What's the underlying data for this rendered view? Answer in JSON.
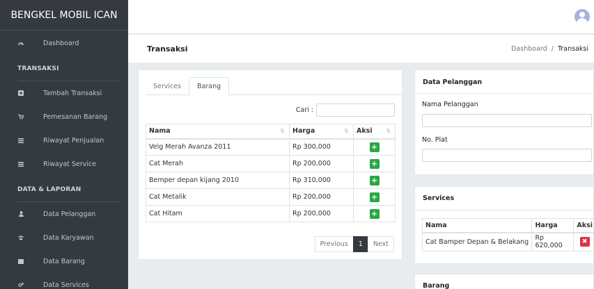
{
  "brand": "BENGKEL MOBIL ICAN",
  "sidebar": {
    "dashboard": {
      "label": "Dashboard",
      "icon": "dashboard-icon"
    },
    "section_transaksi": "TRANSAKSI",
    "transaksi_items": [
      {
        "label": "Tambah Transaksi",
        "icon": "plus-square-icon"
      },
      {
        "label": "Pemesanan Barang",
        "icon": "cart-icon"
      },
      {
        "label": "Riwayat Penjualan",
        "icon": "list-icon"
      },
      {
        "label": "Riwayat Service",
        "icon": "list-icon"
      }
    ],
    "section_laporan": "DATA & LAPORAN",
    "laporan_items": [
      {
        "label": "Data Pelanggan",
        "icon": "user-icon"
      },
      {
        "label": "Data Karyawan",
        "icon": "users-icon"
      },
      {
        "label": "Data Barang",
        "icon": "box-icon"
      },
      {
        "label": "Data Services",
        "icon": "cogs-icon"
      }
    ]
  },
  "header": {
    "title": "Transaksi",
    "breadcrumb": {
      "home": "Dashboard",
      "sep": "/",
      "current": "Transaksi"
    }
  },
  "tabs": [
    "Services",
    "Barang"
  ],
  "active_tab": "Barang",
  "search": {
    "label": "Cari :",
    "value": ""
  },
  "barang_table": {
    "columns": [
      "Nama",
      "Harga",
      "Aksi"
    ],
    "rows": [
      {
        "nama": "Velg Merah Avanza 2011",
        "harga": "Rp 300,000"
      },
      {
        "nama": "Cat Merah",
        "harga": "Rp 200,000"
      },
      {
        "nama": "Bemper depan kijang 2010",
        "harga": "Rp 310,000"
      },
      {
        "nama": "Cat Metalik",
        "harga": "Rp 200,000"
      },
      {
        "nama": "Cat Hitam",
        "harga": "Rp 200,000"
      }
    ],
    "add_symbol": "+"
  },
  "pagination": {
    "previous": "Previous",
    "current": "1",
    "next": "Next"
  },
  "data_pelanggan": {
    "title": "Data Pelanggan",
    "nama_label": "Nama Pelanggan",
    "nama_value": "",
    "plat_label": "No. Plat",
    "plat_value": ""
  },
  "services_card": {
    "title": "Services",
    "columns": [
      "Nama",
      "Harga",
      "Aksi"
    ],
    "rows": [
      {
        "nama": "Cat Bamper Depan & Belakang",
        "harga": "Rp 620,000"
      }
    ],
    "remove_symbol": "✖"
  },
  "barang_card": {
    "title": "Barang"
  },
  "colors": {
    "sidebar": "#343a40",
    "add": "#28a745",
    "remove": "#dc3545",
    "page_active": "#343a40"
  }
}
